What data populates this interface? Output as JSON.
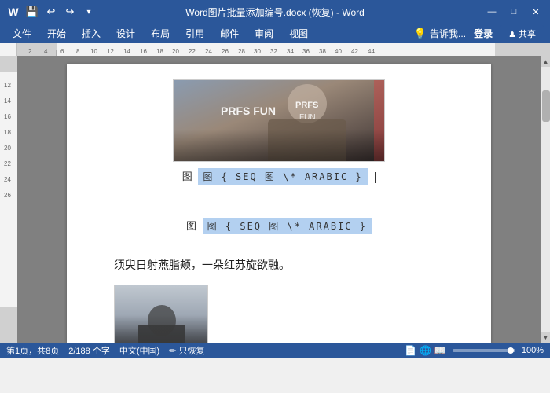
{
  "titleBar": {
    "title": "Word图片批量添加编号.docx (恢复) - Word",
    "appName": "Word",
    "undoIcon": "↩",
    "redoIcon": "↪",
    "saveIcon": "💾",
    "minimizeIcon": "—",
    "maximizeIcon": "□",
    "closeIcon": "✕"
  },
  "menuBar": {
    "items": [
      "文件",
      "开始",
      "插入",
      "设计",
      "布局",
      "引用",
      "邮件",
      "审阅",
      "视图"
    ]
  },
  "toolbar": {
    "tellMe": "告诉我...",
    "login": "登录",
    "share": "♟ 共享"
  },
  "document": {
    "figureLabel1": "图 { SEQ 图 \\* ARABIC }",
    "figureLabel2": "图 { SEQ 图 \\* ARABIC }",
    "chineseText": "须臾日射燕脂颊，一朵红苏旋欲融。"
  },
  "statusBar": {
    "pageInfo": "第1页，共8页",
    "wordCount": "2/188 个字",
    "language": "中文(中国)",
    "editMode": "只恢复",
    "zoom": "100%"
  }
}
